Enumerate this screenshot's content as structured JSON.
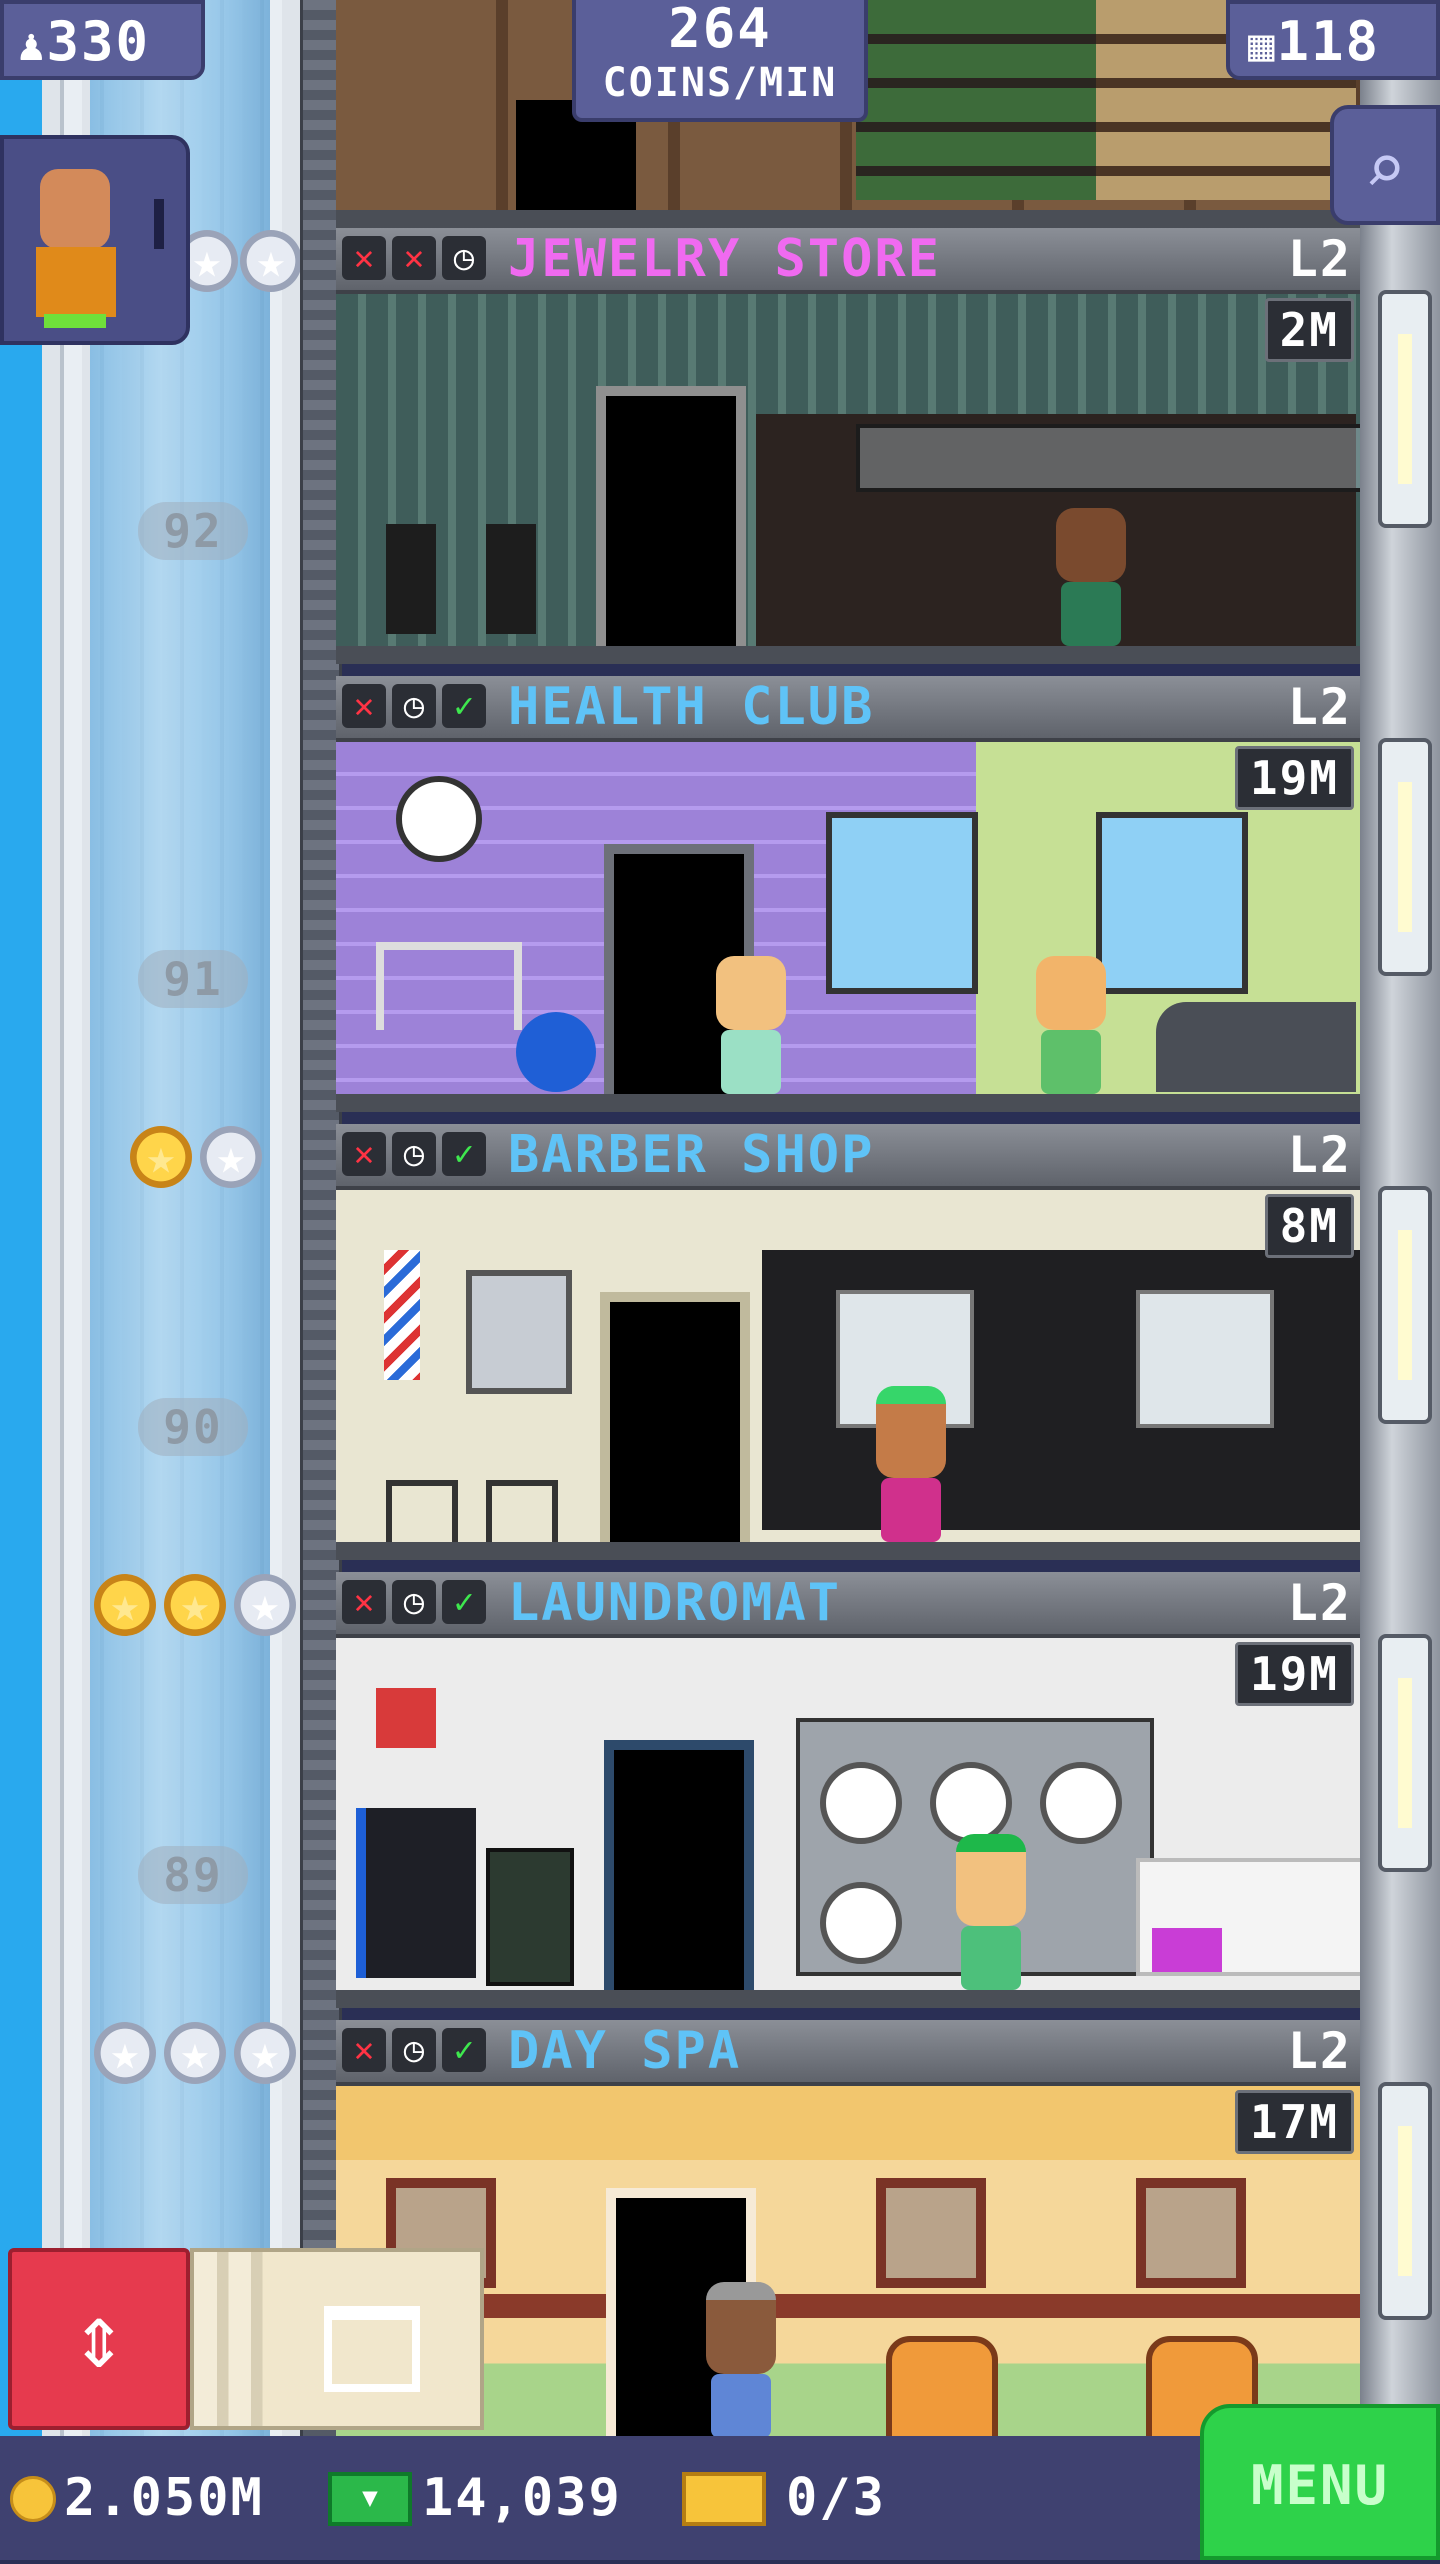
{
  "hud": {
    "population": "330",
    "coins_per_min_value": "264",
    "coins_per_min_unit": "COINS/MIN",
    "floor_count": "118",
    "icons": {
      "population": "person-icon",
      "floors": "building-icon",
      "search": "magnifier-icon"
    }
  },
  "shaft": {
    "floor_numbers": [
      "92",
      "91",
      "90",
      "89"
    ]
  },
  "floors": [
    {
      "name": "JEWELRY STORE",
      "name_color": "#f06af0",
      "level": "L2",
      "stock": "2M",
      "status_icons": [
        "x",
        "x",
        "clock"
      ]
    },
    {
      "name": "HEALTH CLUB",
      "name_color": "#5fc3f7",
      "level": "L2",
      "stock": "19M",
      "status_icons": [
        "x",
        "clock",
        "check"
      ]
    },
    {
      "name": "BARBER SHOP",
      "name_color": "#5fc3f7",
      "level": "L2",
      "stock": "8M",
      "status_icons": [
        "x",
        "clock",
        "check"
      ]
    },
    {
      "name": "LAUNDROMAT",
      "name_color": "#5fc3f7",
      "level": "L2",
      "stock": "19M",
      "status_icons": [
        "x",
        "clock",
        "check"
      ]
    },
    {
      "name": "DAY SPA",
      "name_color": "#5fc3f7",
      "level": "L2",
      "stock": "17M",
      "status_icons": [
        "x",
        "clock",
        "check"
      ]
    }
  ],
  "bottom": {
    "coins": "2.050M",
    "bux": "14,039",
    "tickets": "0/3",
    "menu_label": "MENU"
  },
  "colors": {
    "hud_panel": "#5b5f99",
    "sky": "#29a9ee",
    "menu_green": "#2ed24a",
    "elevator_red": "#e63a4e"
  }
}
